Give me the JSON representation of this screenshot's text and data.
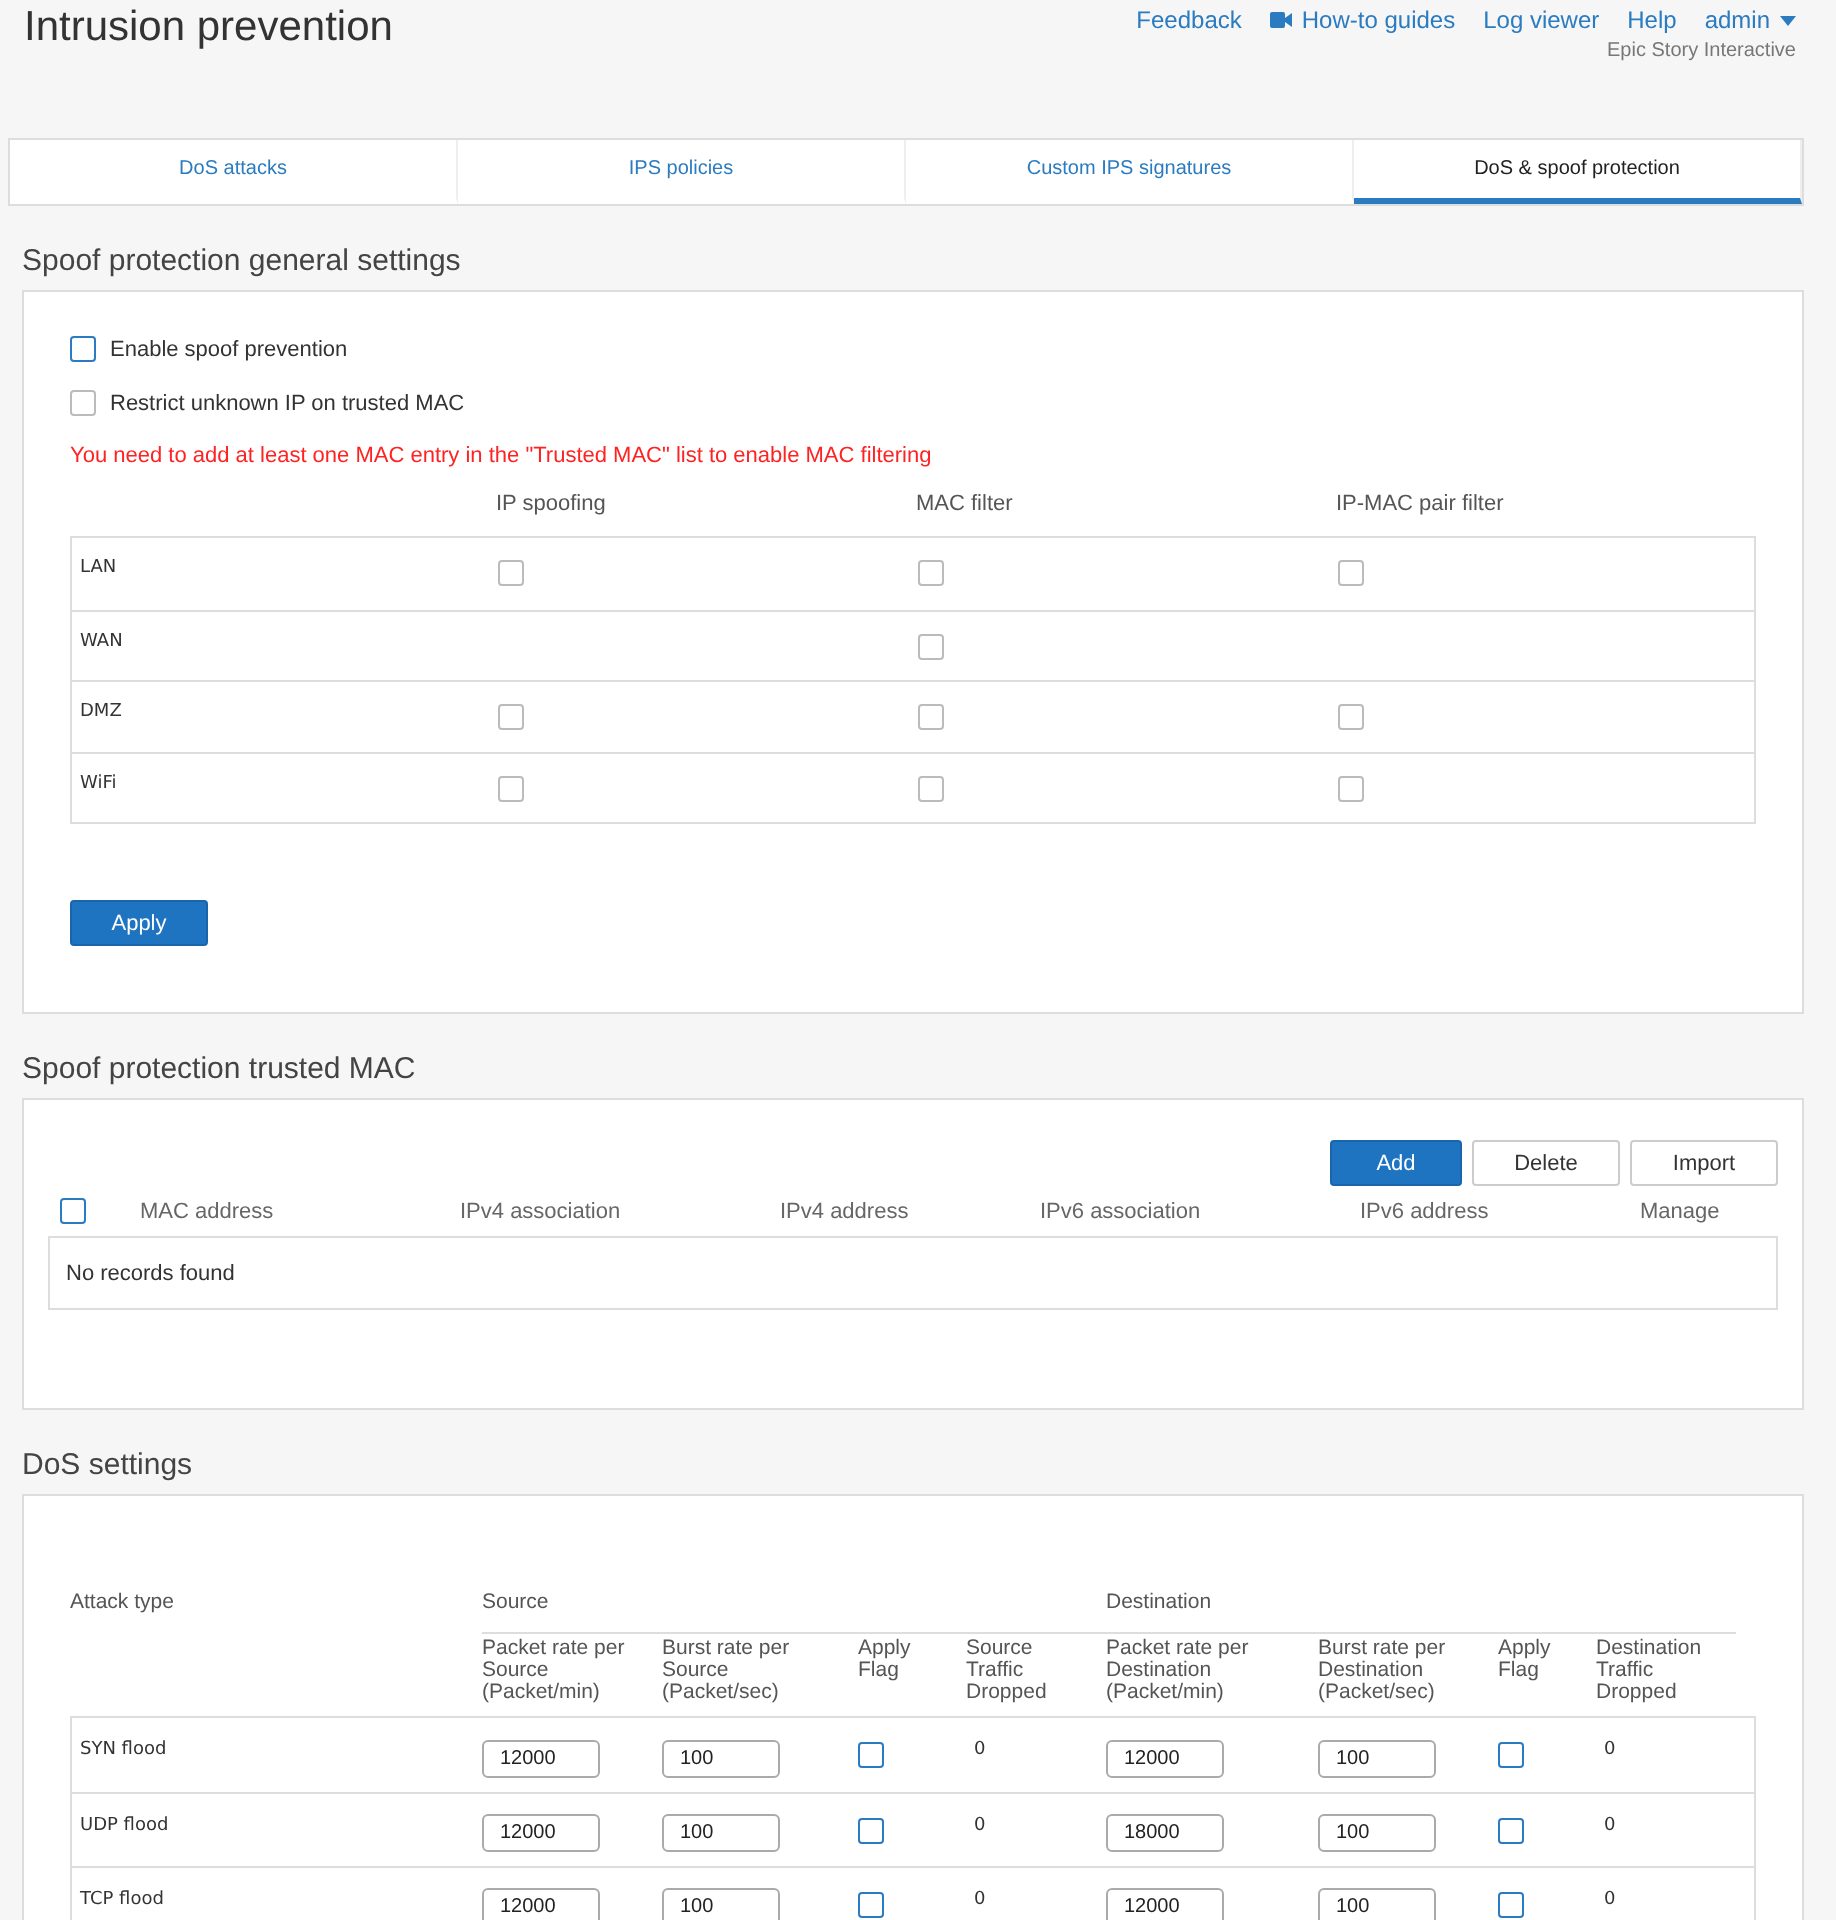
{
  "header": {
    "title": "Intrusion prevention",
    "links": [
      {
        "label": "Feedback",
        "kind": "link"
      },
      {
        "label": "How-to guides",
        "kind": "video"
      },
      {
        "label": "Log viewer",
        "kind": "link"
      },
      {
        "label": "Help",
        "kind": "link"
      },
      {
        "label": "admin",
        "kind": "menu"
      }
    ],
    "subtitle": "Epic Story Interactive"
  },
  "tabs": [
    {
      "label": "DoS attacks",
      "selected": false
    },
    {
      "label": "IPS policies",
      "selected": false
    },
    {
      "label": "Custom IPS signatures",
      "selected": false
    },
    {
      "label": "DoS & spoof protection",
      "selected": true
    }
  ],
  "spoof_settings": {
    "title": "Spoof protection general settings",
    "options": [
      {
        "label": "Enable spoof prevention",
        "checked": false,
        "disabled": false
      },
      {
        "label": "Restrict unknown IP on trusted MAC",
        "checked": false,
        "disabled": true
      }
    ],
    "warning": "You need to add at least one MAC entry in the \"Trusted MAC\" list to enable MAC filtering",
    "columns": [
      "IP spoofing",
      "MAC filter",
      "IP-MAC pair filter"
    ],
    "rows": [
      {
        "zone": "LAN",
        "cells": [
          {
            "checked": false,
            "disabled": true
          },
          {
            "checked": false,
            "disabled": true
          },
          {
            "checked": false,
            "disabled": true
          }
        ]
      },
      {
        "zone": "WAN",
        "cells": [
          null,
          {
            "checked": false,
            "disabled": true
          },
          null
        ]
      },
      {
        "zone": "DMZ",
        "cells": [
          {
            "checked": false,
            "disabled": true
          },
          {
            "checked": false,
            "disabled": true
          },
          {
            "checked": false,
            "disabled": true
          }
        ]
      },
      {
        "zone": "WiFi",
        "cells": [
          {
            "checked": false,
            "disabled": true
          },
          {
            "checked": false,
            "disabled": true
          },
          {
            "checked": false,
            "disabled": true
          }
        ]
      }
    ],
    "apply_button": "Apply"
  },
  "trusted_mac": {
    "title": "Spoof protection trusted MAC",
    "buttons": [
      {
        "label": "Add",
        "kind": "primary"
      },
      {
        "label": "Delete",
        "kind": "secondary"
      },
      {
        "label": "Import",
        "kind": "secondary"
      }
    ],
    "select_all": {
      "checked": false
    },
    "columns": [
      "MAC address",
      "IPv4 association",
      "IPv4 address",
      "IPv6 association",
      "IPv6 address",
      "Manage"
    ],
    "empty_message": "No records found"
  },
  "dos_settings": {
    "title": "DoS settings",
    "attack_type_header": "Attack type",
    "groups": [
      "Source",
      "Destination"
    ],
    "columns": [
      "Packet rate per Source (Packet/min)",
      "Burst rate per Source (Packet/sec)",
      "Apply Flag",
      "Source Traffic Dropped",
      "Packet rate per Destination (Packet/min)",
      "Burst rate per Destination (Packet/sec)",
      "Apply Flag",
      "Destination Traffic Dropped"
    ],
    "rows": [
      {
        "attack": "SYN flood",
        "src_packet_rate": "12000",
        "src_burst_rate": "100",
        "src_apply_flag": false,
        "src_dropped": "0",
        "dst_packet_rate": "12000",
        "dst_burst_rate": "100",
        "dst_apply_flag": false,
        "dst_dropped": "0"
      },
      {
        "attack": "UDP flood",
        "src_packet_rate": "12000",
        "src_burst_rate": "100",
        "src_apply_flag": false,
        "src_dropped": "0",
        "dst_packet_rate": "18000",
        "dst_burst_rate": "100",
        "dst_apply_flag": false,
        "dst_dropped": "0"
      },
      {
        "attack": "TCP flood",
        "src_packet_rate": "12000",
        "src_burst_rate": "100",
        "src_apply_flag": false,
        "src_dropped": "0",
        "dst_packet_rate": "12000",
        "dst_burst_rate": "100",
        "dst_apply_flag": false,
        "dst_dropped": "0"
      }
    ]
  }
}
